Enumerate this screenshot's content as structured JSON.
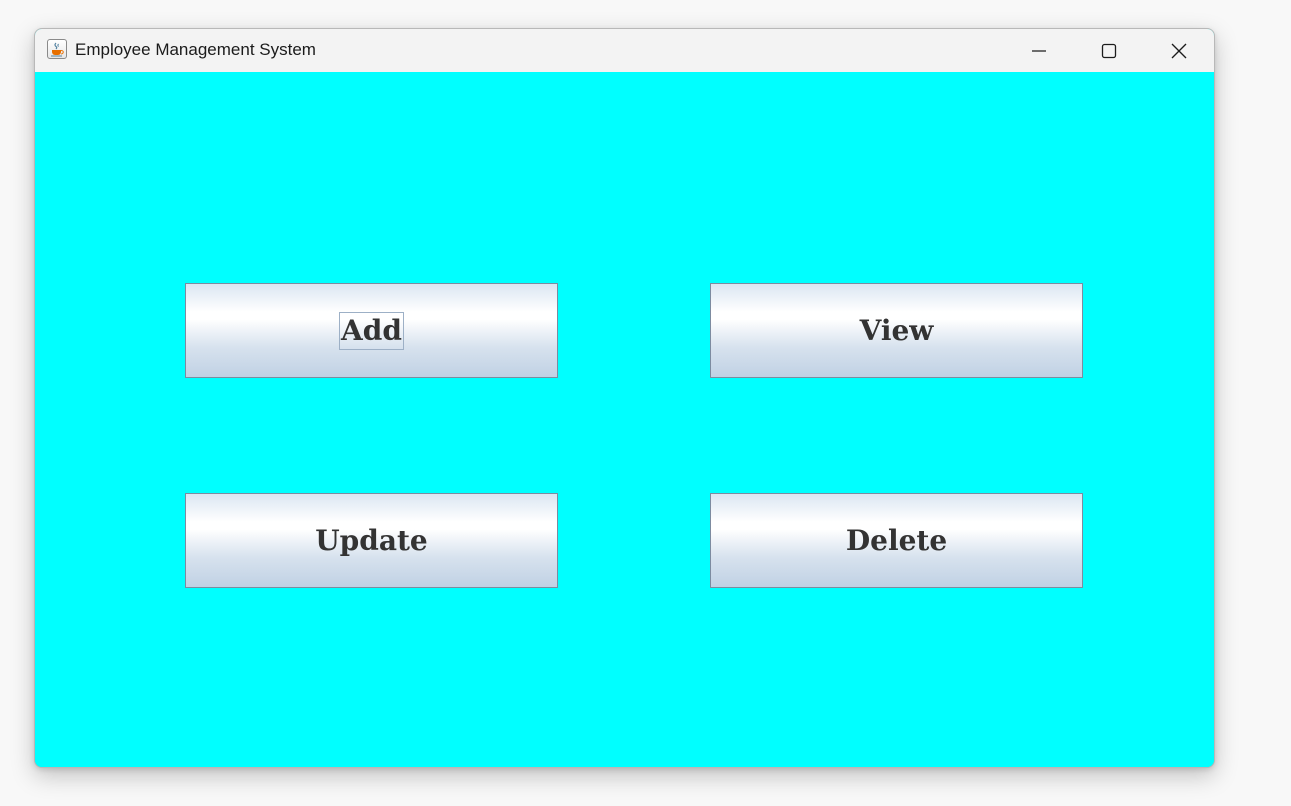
{
  "window": {
    "title": "Employee Management System",
    "icon": "java-cup-icon",
    "controls": [
      "minimize-icon",
      "maximize-icon",
      "close-icon"
    ]
  },
  "colors": {
    "content_background": "#00ffff",
    "titlebar_background": "#f3f3f3",
    "button_text": "#333333"
  },
  "buttons": {
    "add": {
      "label": "Add",
      "focused": true
    },
    "view": {
      "label": "View",
      "focused": false
    },
    "update": {
      "label": "Update",
      "focused": false
    },
    "delete": {
      "label": "Delete",
      "focused": false
    }
  }
}
